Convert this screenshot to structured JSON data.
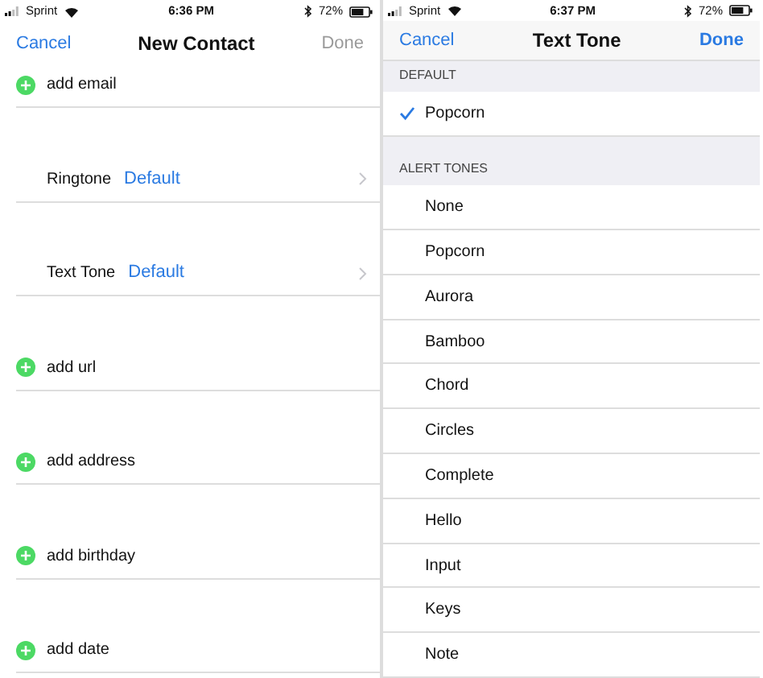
{
  "screens": [
    {
      "status_bar": {
        "carrier": "Sprint",
        "time": "6:36 PM",
        "battery": "72%"
      },
      "nav": {
        "left": "Cancel",
        "title": "New Contact",
        "right": "Done",
        "right_disabled": true
      },
      "rows": [
        {
          "kind": "add",
          "label": "add email"
        },
        {
          "kind": "setting",
          "label": "Ringtone",
          "value": "Default"
        },
        {
          "kind": "setting",
          "label": "Text Tone",
          "value": "Default"
        },
        {
          "kind": "add",
          "label": "add url"
        },
        {
          "kind": "add",
          "label": "add address"
        },
        {
          "kind": "add",
          "label": "add birthday"
        },
        {
          "kind": "add",
          "label": "add date"
        }
      ]
    },
    {
      "status_bar": {
        "carrier": "Sprint",
        "time": "6:37 PM",
        "battery": "72%"
      },
      "nav": {
        "left": "Cancel",
        "title": "Text Tone",
        "right": "Done",
        "right_disabled": false
      },
      "sections": [
        {
          "header": "DEFAULT",
          "items": [
            {
              "label": "Popcorn",
              "selected": true
            }
          ]
        },
        {
          "header": "ALERT TONES",
          "items": [
            {
              "label": "None",
              "selected": false
            },
            {
              "label": "Popcorn",
              "selected": false
            },
            {
              "label": "Aurora",
              "selected": false
            },
            {
              "label": "Bamboo",
              "selected": false
            },
            {
              "label": "Chord",
              "selected": false
            },
            {
              "label": "Circles",
              "selected": false
            },
            {
              "label": "Complete",
              "selected": false
            },
            {
              "label": "Hello",
              "selected": false
            },
            {
              "label": "Input",
              "selected": false
            },
            {
              "label": "Keys",
              "selected": false
            },
            {
              "label": "Note",
              "selected": false
            }
          ]
        }
      ]
    }
  ]
}
